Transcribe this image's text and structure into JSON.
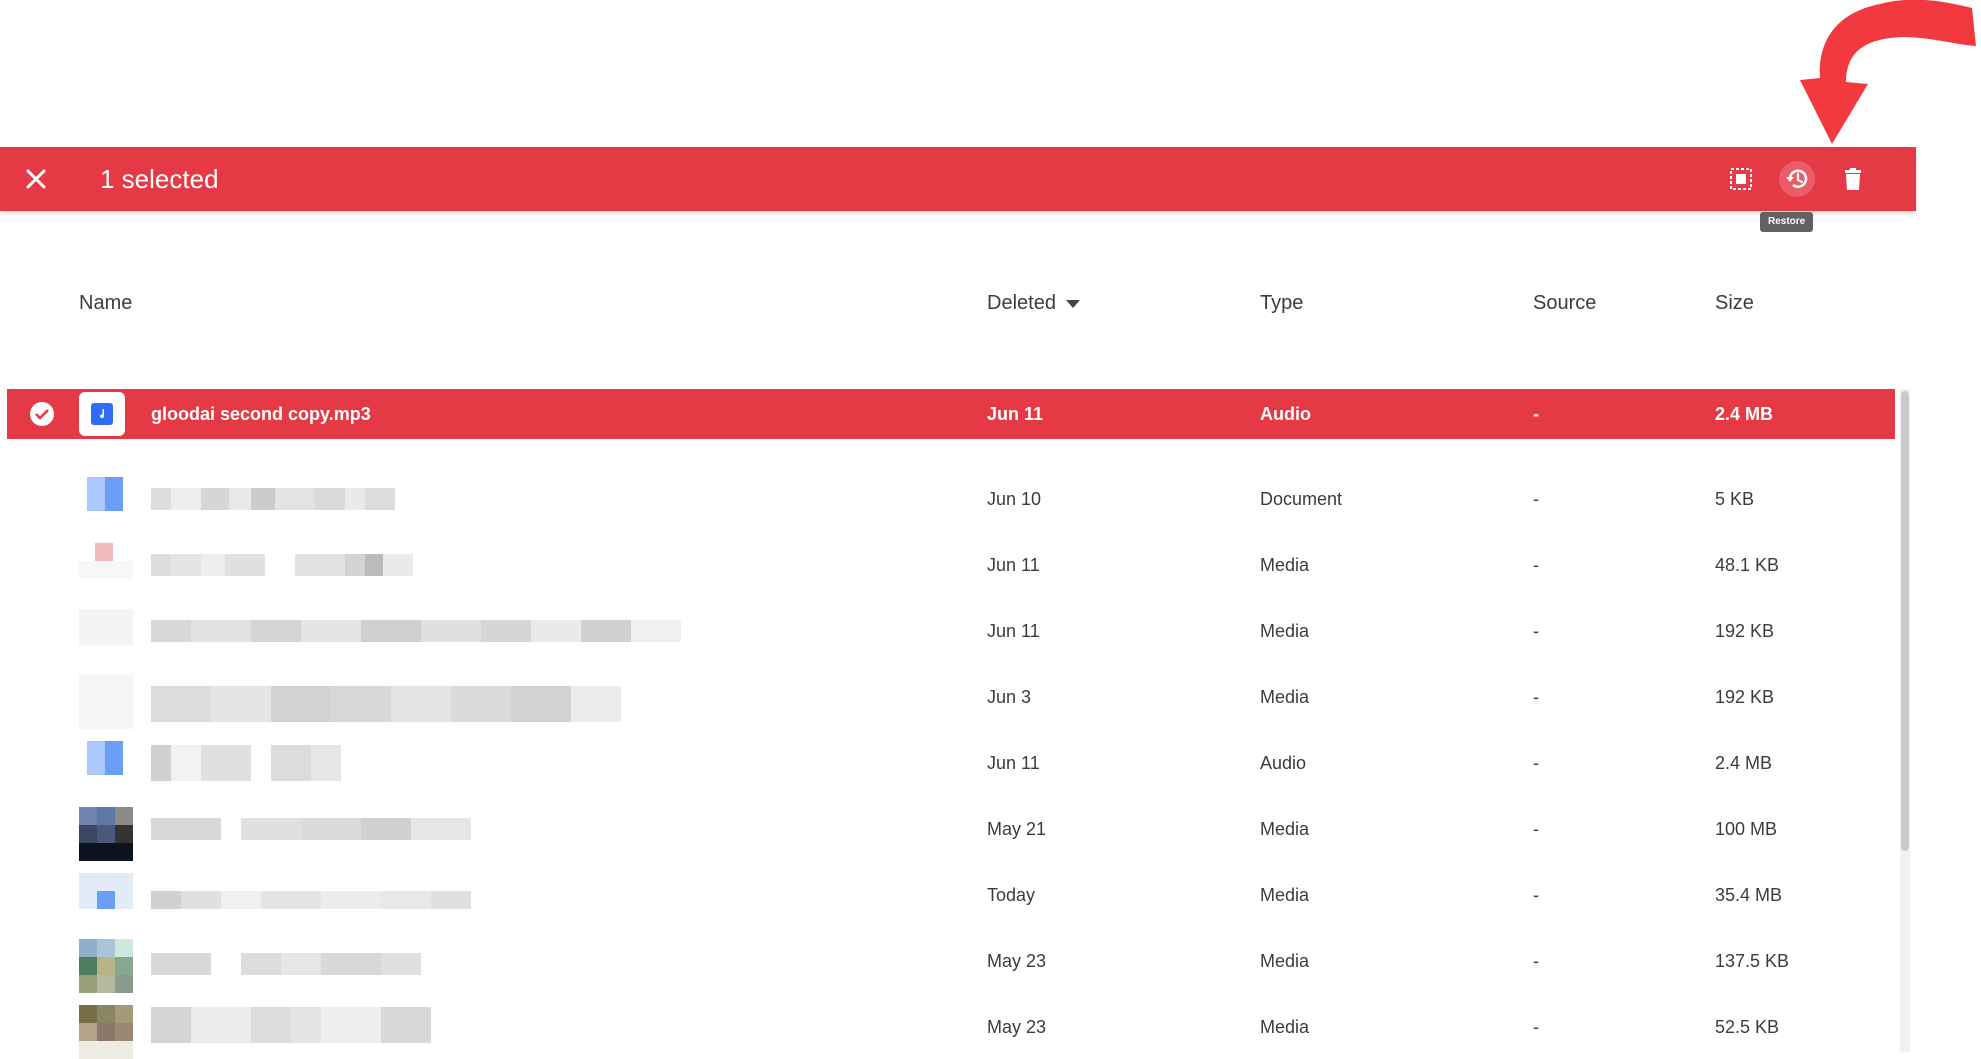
{
  "selection_bar": {
    "count_label": "1 selected",
    "close_icon": "close-icon",
    "actions": [
      {
        "icon": "select-all-icon",
        "label": ""
      },
      {
        "icon": "restore-icon",
        "label": "Restore"
      },
      {
        "icon": "trash-icon",
        "label": ""
      }
    ],
    "tooltip": "Restore",
    "color": "#e63946"
  },
  "annotation": {
    "arrow_color": "#f2393f"
  },
  "table": {
    "headers": {
      "name": "Name",
      "deleted": "Deleted",
      "type": "Type",
      "source": "Source",
      "size": "Size"
    },
    "sort_indicator": "caret-down-icon",
    "rows": [
      {
        "name": "gloodai second copy.mp3",
        "deleted": "Jun 11",
        "type": "Audio",
        "source": "-",
        "size": "2.4 MB",
        "selected": true
      },
      {
        "name": "",
        "deleted": "Jun 10",
        "type": "Document",
        "source": "-",
        "size": "5 KB"
      },
      {
        "name": "",
        "deleted": "Jun 11",
        "type": "Media",
        "source": "-",
        "size": "48.1 KB"
      },
      {
        "name": "",
        "deleted": "Jun 11",
        "type": "Media",
        "source": "-",
        "size": "192 KB"
      },
      {
        "name": "",
        "deleted": "Jun 3",
        "type": "Media",
        "source": "-",
        "size": "192 KB"
      },
      {
        "name": "",
        "deleted": "Jun 11",
        "type": "Audio",
        "source": "-",
        "size": "2.4 MB"
      },
      {
        "name": "",
        "deleted": "May 21",
        "type": "Media",
        "source": "-",
        "size": "100 MB"
      },
      {
        "name": "",
        "deleted": "Today",
        "type": "Media",
        "source": "-",
        "size": "35.4 MB"
      },
      {
        "name": "",
        "deleted": "May 23",
        "type": "Media",
        "source": "-",
        "size": "137.5 KB"
      },
      {
        "name": "",
        "deleted": "May 23",
        "type": "Media",
        "source": "-",
        "size": "52.5 KB"
      }
    ]
  }
}
